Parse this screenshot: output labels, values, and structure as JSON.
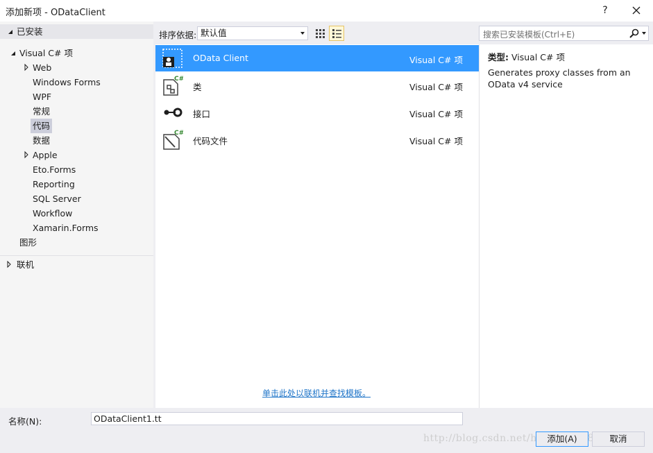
{
  "window": {
    "title": "添加新项 - ODataClient",
    "help_label": "?"
  },
  "tree": {
    "installed": "已安装",
    "visual_csharp": "Visual C# 项",
    "items": [
      "Web",
      "Windows Forms",
      "WPF",
      "常规",
      "代码",
      "数据",
      "Apple",
      "Eto.Forms",
      "Reporting",
      "SQL Server",
      "Workflow",
      "Xamarin.Forms"
    ],
    "graphics": "图形",
    "online": "联机"
  },
  "sort": {
    "label": "排序依据:",
    "value": "默认值"
  },
  "search": {
    "placeholder": "搜索已安装模板(Ctrl+E)"
  },
  "templates": [
    {
      "name": "OData Client",
      "lang": "Visual C# 项"
    },
    {
      "name": "类",
      "lang": "Visual C# 项"
    },
    {
      "name": "接口",
      "lang": "Visual C# 项"
    },
    {
      "name": "代码文件",
      "lang": "Visual C# 项"
    }
  ],
  "online_link": "单击此处以联机并查找模板。",
  "details": {
    "type_label": "类型:",
    "type_value": "Visual C# 项",
    "description": "Generates proxy classes from an OData v4 service"
  },
  "name_field": {
    "label": "名称(N):",
    "value": "ODataClient1.tt"
  },
  "buttons": {
    "add": "添加(A)",
    "cancel": "取消"
  },
  "watermark": "http://blog.csdn.net/hoodsun808",
  "colors": {
    "selection": "#3399ff",
    "link": "#1e74c8",
    "chrome": "#eeeef2"
  }
}
